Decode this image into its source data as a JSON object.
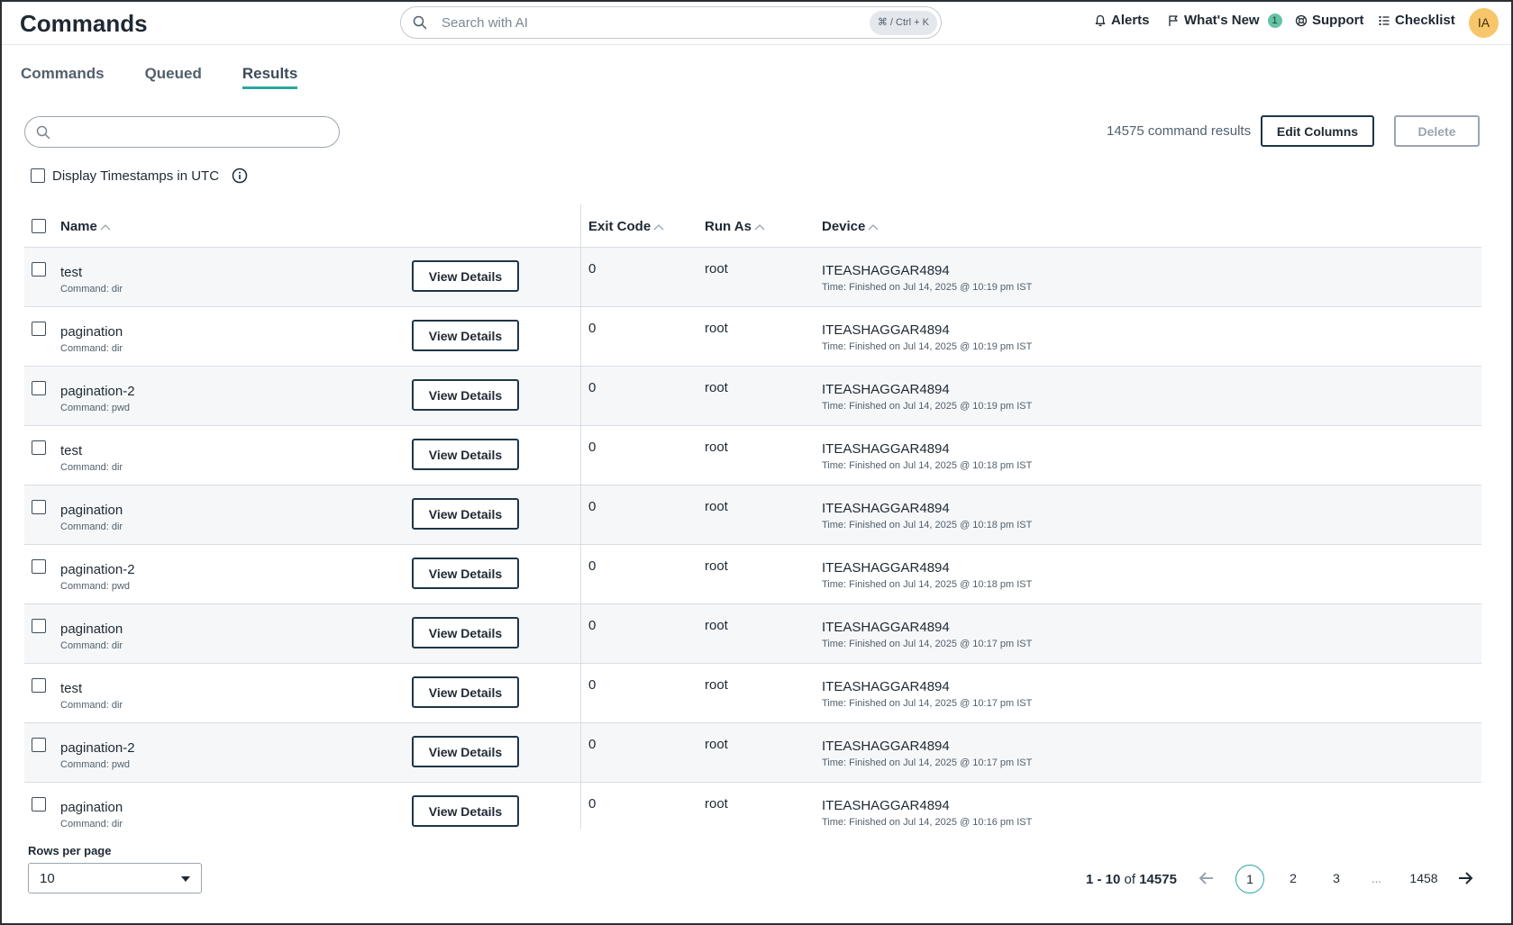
{
  "header": {
    "title": "Commands",
    "search_placeholder": "Search with AI",
    "shortcut": "⌘ / Ctrl + K",
    "alerts": "Alerts",
    "whats_new": "What's New",
    "whats_new_count": "1",
    "support": "Support",
    "checklist": "Checklist",
    "avatar_initials": "IA"
  },
  "tabs": [
    {
      "label": "Commands",
      "active": false
    },
    {
      "label": "Queued",
      "active": false
    },
    {
      "label": "Results",
      "active": true
    }
  ],
  "toolbar": {
    "search_value": "",
    "results_count": "14575 command results",
    "edit_columns": "Edit Columns",
    "delete": "Delete",
    "utc_label": "Display Timestamps in UTC",
    "utc_checked": false
  },
  "table": {
    "columns": {
      "name": "Name",
      "exit_code": "Exit Code",
      "run_as": "Run As",
      "device": "Device"
    },
    "action_label": "View Details",
    "rows": [
      {
        "name": "test",
        "command": "Command: dir",
        "exit_code": "0",
        "run_as": "root",
        "device": "ITEASHAGGAR4894",
        "time": "Time: Finished on Jul 14, 2025 @ 10:19 pm IST"
      },
      {
        "name": "pagination",
        "command": "Command: dir",
        "exit_code": "0",
        "run_as": "root",
        "device": "ITEASHAGGAR4894",
        "time": "Time: Finished on Jul 14, 2025 @ 10:19 pm IST"
      },
      {
        "name": "pagination-2",
        "command": "Command: pwd",
        "exit_code": "0",
        "run_as": "root",
        "device": "ITEASHAGGAR4894",
        "time": "Time: Finished on Jul 14, 2025 @ 10:19 pm IST"
      },
      {
        "name": "test",
        "command": "Command: dir",
        "exit_code": "0",
        "run_as": "root",
        "device": "ITEASHAGGAR4894",
        "time": "Time: Finished on Jul 14, 2025 @ 10:18 pm IST"
      },
      {
        "name": "pagination",
        "command": "Command: dir",
        "exit_code": "0",
        "run_as": "root",
        "device": "ITEASHAGGAR4894",
        "time": "Time: Finished on Jul 14, 2025 @ 10:18 pm IST"
      },
      {
        "name": "pagination-2",
        "command": "Command: pwd",
        "exit_code": "0",
        "run_as": "root",
        "device": "ITEASHAGGAR4894",
        "time": "Time: Finished on Jul 14, 2025 @ 10:18 pm IST"
      },
      {
        "name": "pagination",
        "command": "Command: dir",
        "exit_code": "0",
        "run_as": "root",
        "device": "ITEASHAGGAR4894",
        "time": "Time: Finished on Jul 14, 2025 @ 10:17 pm IST"
      },
      {
        "name": "test",
        "command": "Command: dir",
        "exit_code": "0",
        "run_as": "root",
        "device": "ITEASHAGGAR4894",
        "time": "Time: Finished on Jul 14, 2025 @ 10:17 pm IST"
      },
      {
        "name": "pagination-2",
        "command": "Command: pwd",
        "exit_code": "0",
        "run_as": "root",
        "device": "ITEASHAGGAR4894",
        "time": "Time: Finished on Jul 14, 2025 @ 10:17 pm IST"
      },
      {
        "name": "pagination",
        "command": "Command: dir",
        "exit_code": "0",
        "run_as": "root",
        "device": "ITEASHAGGAR4894",
        "time": "Time: Finished on Jul 14, 2025 @ 10:16 pm IST"
      }
    ]
  },
  "footer": {
    "rows_per_page_label": "Rows per page",
    "rows_per_page": "10",
    "range_start": "1 - 10",
    "range_of": "of",
    "range_total": "14575",
    "pages": [
      "1",
      "2",
      "3"
    ],
    "ellipsis": "...",
    "last_page": "1458",
    "current_page": "1"
  },
  "colors": {
    "accent": "#2aa7a0",
    "badge": "#66c2a5",
    "avatar": "#f8c66a",
    "border_dark": "#1f3548"
  }
}
